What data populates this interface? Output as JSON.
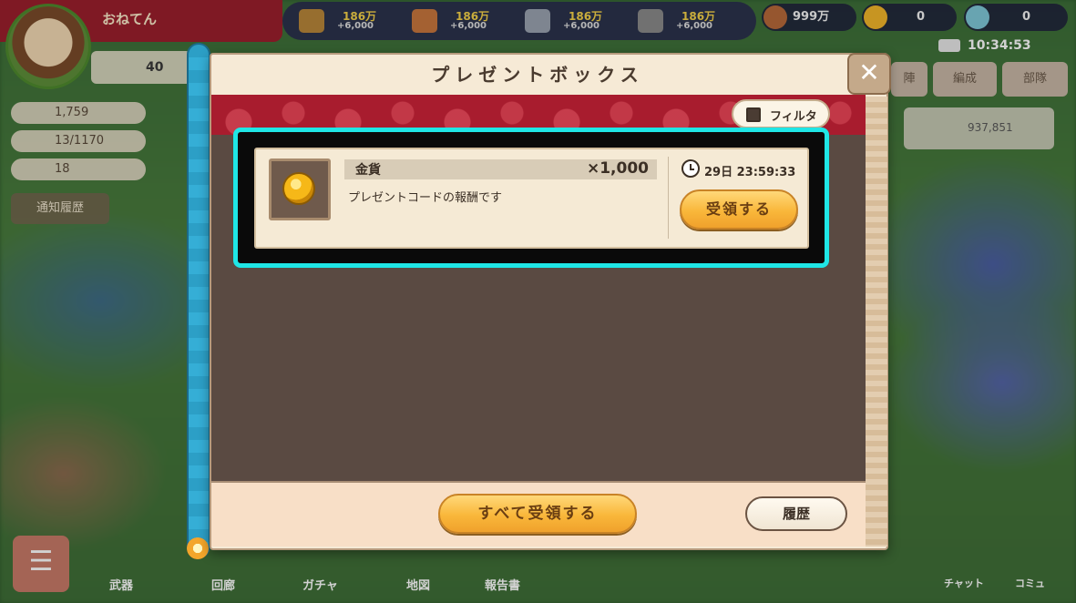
{
  "background": {
    "player": {
      "name": "おねてん",
      "level": "40"
    },
    "left_resources": [
      "1,759",
      "13/1170",
      "18"
    ],
    "notify_label": "通知履歴",
    "top_resources": [
      {
        "value": "186万",
        "sub": "+6,000",
        "icon": "wood-icon",
        "color": "#b9873a"
      },
      {
        "value": "186万",
        "sub": "+6,000",
        "icon": "food-icon",
        "color": "#c8773e"
      },
      {
        "value": "186万",
        "sub": "+6,000",
        "icon": "iron-icon",
        "color": "#9aa3b0"
      },
      {
        "value": "186万",
        "sub": "+6,000",
        "icon": "stone-icon",
        "color": "#8a8a8a"
      }
    ],
    "pills": [
      {
        "value": "999万",
        "icon": "coin-bag-icon",
        "color": "#b8693a"
      },
      {
        "value": "0",
        "icon": "sun-gem-icon",
        "color": "#f3b62a"
      },
      {
        "value": "0",
        "icon": "crystal-icon",
        "color": "#7fc9d8"
      }
    ],
    "clock": "10:34:53",
    "right_tabs": [
      "陣",
      "編成",
      "部隊"
    ],
    "right_card_text": "937,851",
    "nav_labels": [
      "武器",
      "回廊",
      "ガチャ",
      "地図",
      "報告書",
      "チャット",
      "コミュ"
    ]
  },
  "dialog": {
    "title": "プレゼントボックス",
    "close_label": "✕",
    "filter_label": "フィルタ",
    "items": [
      {
        "name": "金貨",
        "quantity": "×1,000",
        "description": "プレゼントコードの報酬です",
        "expiry": "29日 23:59:33",
        "claim_label": "受領する",
        "icon": "gold-coin-icon"
      }
    ],
    "claim_all_label": "すべて受領する",
    "history_label": "履歴"
  },
  "colors": {
    "highlight": "#1fe6e6",
    "banner_red": "#a81c2e",
    "button_gold": "#f9b73a",
    "scroll_blue": "#2c9fc6"
  }
}
